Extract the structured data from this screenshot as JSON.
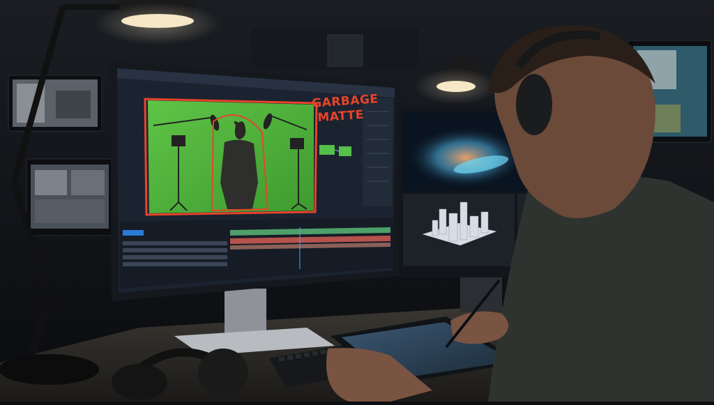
{
  "scene": {
    "description_free": true,
    "annotation": {
      "line1": "GARBAGE",
      "line2": "MATTE",
      "color": "#e8442a"
    },
    "colors": {
      "greenscreen": "#4fb23a",
      "ui_panel": "#1c2330",
      "timeline_bar_red": "#b5524c",
      "timeline_bar_green": "#4f9f6a",
      "ui_accent_blue": "#2a7bd6",
      "lamp_glow": "#f6e7c6"
    },
    "icons": [
      "desk-lamp-icon",
      "headphones-icon",
      "stylus-pen-icon",
      "keyboard-icon",
      "tripod-light-icon",
      "boom-mic-icon"
    ]
  }
}
